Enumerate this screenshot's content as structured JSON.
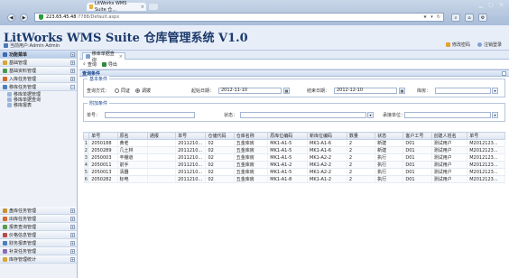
{
  "browser": {
    "tab_title": "LitWorks WMS Suite 仓...",
    "address_host": "223.65.45.48",
    "address_path": ":7788/Default.aspx"
  },
  "app": {
    "title": "LitWorks WMS Suite 仓库管理系统 V1.0",
    "user_line": "当前用户:Admin Admin",
    "change_password": "修改密码",
    "logout": "注销登录"
  },
  "nav": {
    "top_items": [
      {
        "label": "功能菜单",
        "active": true
      },
      {
        "label": "基础管理"
      },
      {
        "label": "基础资料管理"
      },
      {
        "label": "入库任务管理"
      },
      {
        "label": "移库任务管理"
      }
    ],
    "sub_items": [
      "移库单据管理",
      "移库单据查询",
      "移库报表"
    ],
    "bottom_items": [
      "盘库任务管理",
      "出库任务管理",
      "报表查询管理",
      "价格信息管理",
      "财务报表管理",
      "补货任务管理",
      "库存管理统计"
    ]
  },
  "content": {
    "tab_label": "移库单据查询",
    "toolbar": {
      "query": "查询",
      "export": "导出"
    },
    "panel_title": "查询条件",
    "basic_legend": "基本条件",
    "query_mode_label": "查询方式：",
    "radio_same": "同证",
    "radio_other": "调拨",
    "start_date_label": "起始日期：",
    "start_date": "2012-11-10",
    "end_date_label": "结束日期：",
    "end_date": "2012-12-10",
    "warehouse_label": "库房：",
    "extra_legend": "附加条件",
    "doc_no_label": "单号：",
    "status_label": "状态：",
    "supplier_label": "承接单位："
  },
  "grid": {
    "columns": [
      "单号",
      "原名",
      "通报",
      "单号",
      "仓储代码",
      "仓库名称",
      "原库位编码",
      "新库位编码",
      "数量",
      "状态",
      "客户工号",
      "创建人姓名",
      "单号"
    ],
    "rows": [
      [
        "2050188",
        "黄老",
        "",
        "2011210...",
        "02",
        "五金库房",
        "MK1-A1-5",
        "MK1-A1-6",
        "2",
        "新建",
        "D01",
        "测试用户",
        "M2012123..."
      ],
      [
        "2050289",
        "几土林",
        "",
        "2011210...",
        "02",
        "五金库房",
        "MK1-A1-5",
        "MK1-A1-6",
        "2",
        "新建",
        "D01",
        "测试用户",
        "M2012123..."
      ],
      [
        "2050003",
        "丰棚道",
        "",
        "2011210...",
        "02",
        "五金库房",
        "MK1-A1-5",
        "MK1-A2-2",
        "2",
        "执行",
        "D01",
        "测试用户",
        "M2012123..."
      ],
      [
        "2050011",
        "前手",
        "",
        "2011210...",
        "02",
        "五金库房",
        "MK1-A1-2",
        "MK1-A2-2",
        "2",
        "执行",
        "D01",
        "测试用户",
        "M2012123..."
      ],
      [
        "2050013",
        "清器",
        "",
        "2011210...",
        "02",
        "五金库房",
        "MK1-A1-5",
        "MK1-A2-2",
        "2",
        "执行",
        "D01",
        "测试用户",
        "M2012123..."
      ],
      [
        "2050282",
        "标电",
        "",
        "2011210...",
        "02",
        "五金库房",
        "MK1-A1-8",
        "MK1-A1-2",
        "2",
        "执行",
        "D01",
        "测试用户",
        "M2012123..."
      ]
    ]
  }
}
